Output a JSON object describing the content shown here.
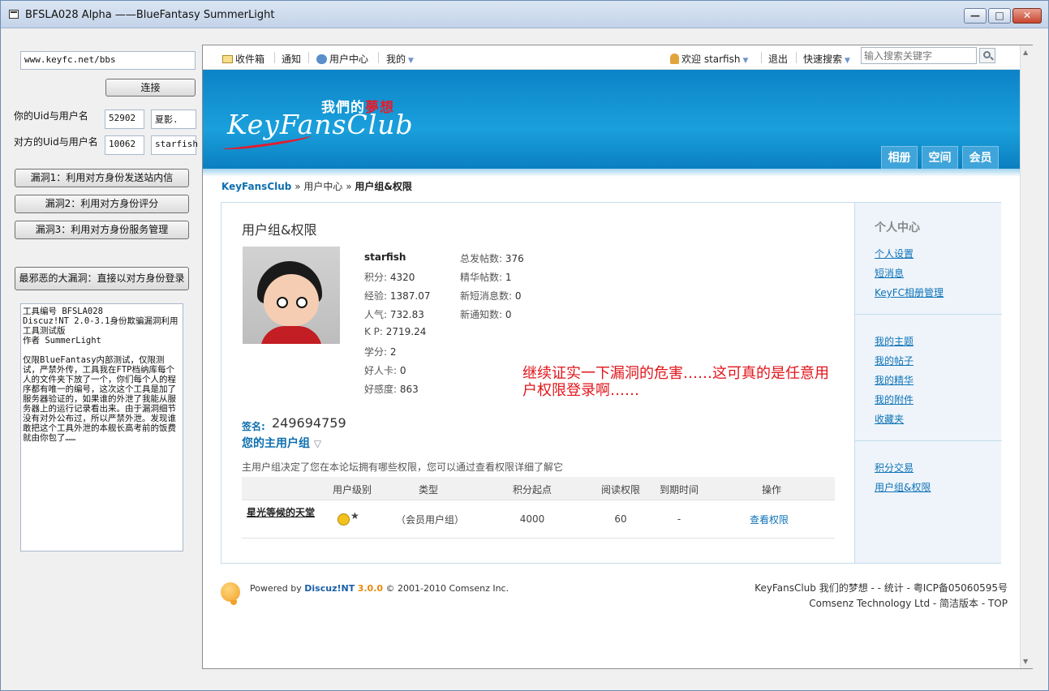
{
  "window": {
    "title": "BFSLA028 Alpha ——BlueFantasy SummerLight",
    "min_glyph": "—",
    "max_glyph": "□",
    "close_glyph": "✕"
  },
  "left_panel": {
    "url_value": "www.keyfc.net/bbs",
    "connect_button": "连接",
    "my_label": "你的Uid与用户名",
    "my_uid": "52902",
    "my_name": "夏影.",
    "target_label": "对方的Uid与用户名",
    "target_uid": "10062",
    "target_name": "starfish",
    "vuln1_button": "漏洞1：利用对方身份发送站内信",
    "vuln2_button": "漏洞2：利用对方身份评分",
    "vuln3_button": "漏洞3：利用对方身份服务管理",
    "vuln_big_button": "最邪恶的大漏洞：直接以对方身份登录",
    "info_text": "工具编号 BFSLA028\nDiscuz!NT 2.0-3.1身份欺骗漏洞利用工具测试版\n作者 SummerLight\n\n仅限BlueFantasy内部测试，仅限测试，严禁外传，工具我在FTP档纳库每个人的文件夹下放了一个，你们每个人的程序都有唯一的编号，这次这个工具是加了服务器验证的，如果谁的外泄了我能从服务器上的运行记录看出来。由于漏洞细节没有对外公布过，所以严禁外泄。发现谁敢把这个工具外泄的本舰长高考前的饭费就由你包了……"
  },
  "browser": {
    "topnav": {
      "inbox": "收件箱",
      "notify": "通知",
      "user_center": "用户中心",
      "mine": "我的",
      "welcome": "欢迎 starfish",
      "logout": "退出",
      "quick_search": "快速搜索",
      "search_placeholder": "输入搜索关键字"
    },
    "logo": {
      "cn_part1": "我們的",
      "cn_part2": "夢想",
      "en": "KeyFansClub"
    },
    "banner_tabs": [
      "相册",
      "空间",
      "会员"
    ],
    "breadcrumb": {
      "home": "KeyFansClub",
      "sep1": "»",
      "user_center": "用户中心",
      "sep2": "»",
      "current": "用户组&权限"
    },
    "panel": {
      "title": "用户组&权限",
      "username": "starfish",
      "stats_left": [
        {
          "label": "积分: ",
          "value": "4320"
        },
        {
          "label": "经验: ",
          "value": "1387.07"
        },
        {
          "label": "人气: ",
          "value": "732.83"
        },
        {
          "label": "K P: ",
          "value": "2719.24"
        },
        {
          "label": "学分: ",
          "value": "2"
        },
        {
          "label": "好人卡: ",
          "value": "0"
        },
        {
          "label": "好感度: ",
          "value": "863"
        }
      ],
      "stats_right": [
        {
          "label": "总发帖数: ",
          "value": "376"
        },
        {
          "label": "精华帖数: ",
          "value": "1"
        },
        {
          "label": "新短消息数: ",
          "value": "0"
        },
        {
          "label": "新通知数: ",
          "value": "0"
        }
      ],
      "annotation": "继续证实一下漏洞的危害……这可真的是任意用户权限登录啊……",
      "sig_label": "签名:",
      "sig_value": "249694759",
      "group_title": "您的主用户组",
      "group_title_icon": "▽",
      "group_desc": "主用户组决定了您在本论坛拥有哪些权限，您可以通过查看权限详细了解它",
      "table_headers": [
        "用户级别",
        "类型",
        "积分起点",
        "阅读权限",
        "到期时间",
        "操作"
      ],
      "table_row": {
        "name": "星光等候的天堂",
        "star_glyph": "★",
        "type": "（会员用户组）",
        "points_start": "4000",
        "read_perm": "60",
        "expire": "-",
        "action": "查看权限"
      }
    },
    "sidebar": {
      "title": "个人中心",
      "group1": [
        "个人设置",
        "短消息",
        "KeyFC相册管理"
      ],
      "group2": [
        "我的主题",
        "我的帖子",
        "我的精华",
        "我的附件",
        "收藏夹"
      ],
      "group3": [
        "积分交易",
        "用户组&权限"
      ]
    },
    "footer": {
      "powered_prefix": "Powered by ",
      "powered_product": "Discuz!NT",
      "powered_version": "3.0.0",
      "powered_suffix": " © 2001-2010 Comsenz Inc.",
      "right_line1": "KeyFansClub 我们的梦想 - - 统计 - 粤ICP备05060595号",
      "right_line2": "Comsenz Technology Ltd - 简洁版本 - TOP"
    }
  }
}
